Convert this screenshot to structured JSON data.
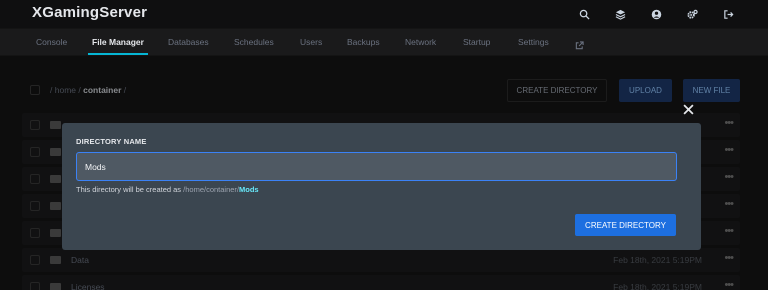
{
  "app": {
    "brand": "XGamingServer"
  },
  "header_icons": [
    "search-icon",
    "layers-icon",
    "account-icon",
    "settings-icon",
    "sign-out-icon"
  ],
  "subnav": {
    "items": [
      "Console",
      "File Manager",
      "Databases",
      "Schedules",
      "Users",
      "Backups",
      "Network",
      "Startup",
      "Settings"
    ],
    "active": "File Manager",
    "external_icon": "external-link-icon"
  },
  "file_manager": {
    "breadcrumb": {
      "root_sep": "/",
      "home": "home",
      "sep": "/",
      "current": "container",
      "trail_sep": "/"
    },
    "buttons": {
      "create_directory": "CREATE DIRECTORY",
      "upload": "UPLOAD",
      "new_file": "NEW FILE"
    },
    "rows": [
      {
        "name": "",
        "date": ""
      },
      {
        "name": "",
        "date": ""
      },
      {
        "name": "",
        "date": ""
      },
      {
        "name": "",
        "date": ""
      },
      {
        "name": "",
        "date": ""
      },
      {
        "name": "Data",
        "date": "Feb 18th, 2021 5:19PM"
      },
      {
        "name": "Licenses",
        "date": "Feb 18th, 2021 5:19PM"
      }
    ],
    "row_menu": "•••"
  },
  "modal": {
    "label": "DIRECTORY NAME",
    "input_value": "Mods",
    "hint_prefix": "This directory will be created as",
    "hint_path": "/home/container/",
    "hint_dir": "Mods",
    "submit": "CREATE DIRECTORY",
    "close_icon": "close-icon"
  },
  "colors": {
    "accent": "#1d6fe0",
    "active_tab": "#06b6d4",
    "modal_bg": "#3b4650"
  }
}
